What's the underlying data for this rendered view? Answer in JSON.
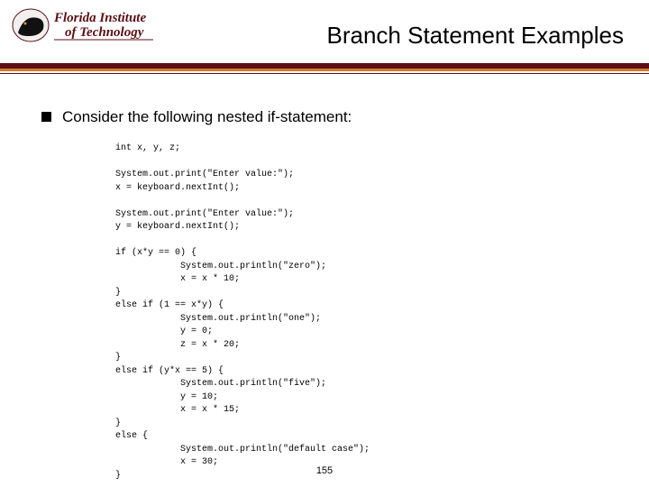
{
  "header": {
    "institution_top": "Florida Institute",
    "institution_bottom": "of Technology",
    "title": "Branch Statement Examples"
  },
  "bullet": {
    "text": "Consider the following nested if-statement:"
  },
  "code": "int x, y, z;\n\nSystem.out.print(\"Enter value:\");\nx = keyboard.nextInt();\n\nSystem.out.print(\"Enter value:\");\ny = keyboard.nextInt();\n\nif (x*y == 0) {\n            System.out.println(\"zero\");\n            x = x * 10;\n}\nelse if (1 == x*y) {\n            System.out.println(\"one\");\n            y = 0;\n            z = x * 20;\n}\nelse if (y*x == 5) {\n            System.out.println(\"five\");\n            y = 10;\n            x = x * 15;\n}\nelse {\n            System.out.println(\"default case\");\n            x = 30;\n}",
  "page_number": "155"
}
